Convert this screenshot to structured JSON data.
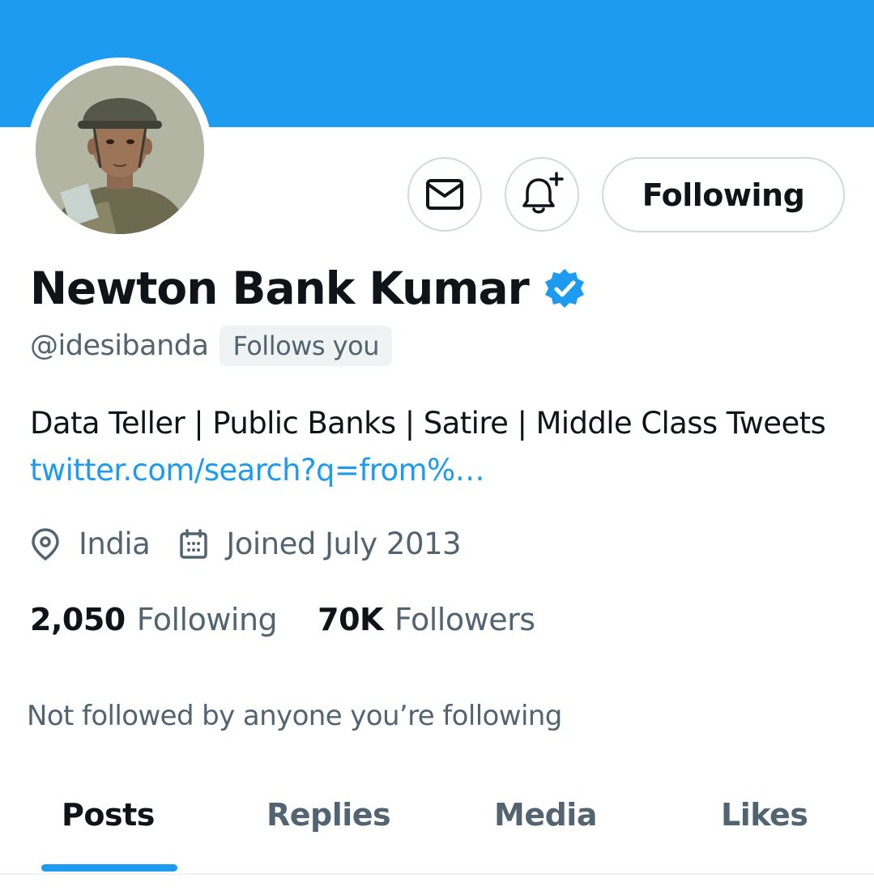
{
  "profile": {
    "display_name": "Newton Bank Kumar",
    "handle": "@idesibanda",
    "follows_you_label": "Follows you",
    "verified": true,
    "bio_text": "Data Teller | Public Banks | Satire | Middle Class Tweets ",
    "bio_link": "twitter.com/search?q=from%…",
    "location": "India",
    "joined": "Joined July 2013"
  },
  "actions": {
    "message_icon": "envelope-icon",
    "notification_icon": "bell-plus-icon",
    "following_label": "Following"
  },
  "stats": {
    "following_count": "2,050",
    "following_label": "Following",
    "followers_count": "70K",
    "followers_label": "Followers"
  },
  "mutuals_text": "Not followed by anyone you’re following",
  "tabs": [
    {
      "label": "Posts",
      "active": true
    },
    {
      "label": "Replies",
      "active": false
    },
    {
      "label": "Media",
      "active": false
    },
    {
      "label": "Likes",
      "active": false
    }
  ],
  "colors": {
    "accent": "#1d9bf0",
    "text_primary": "#0f1419",
    "text_secondary": "#536471",
    "border": "#cfd9de"
  }
}
